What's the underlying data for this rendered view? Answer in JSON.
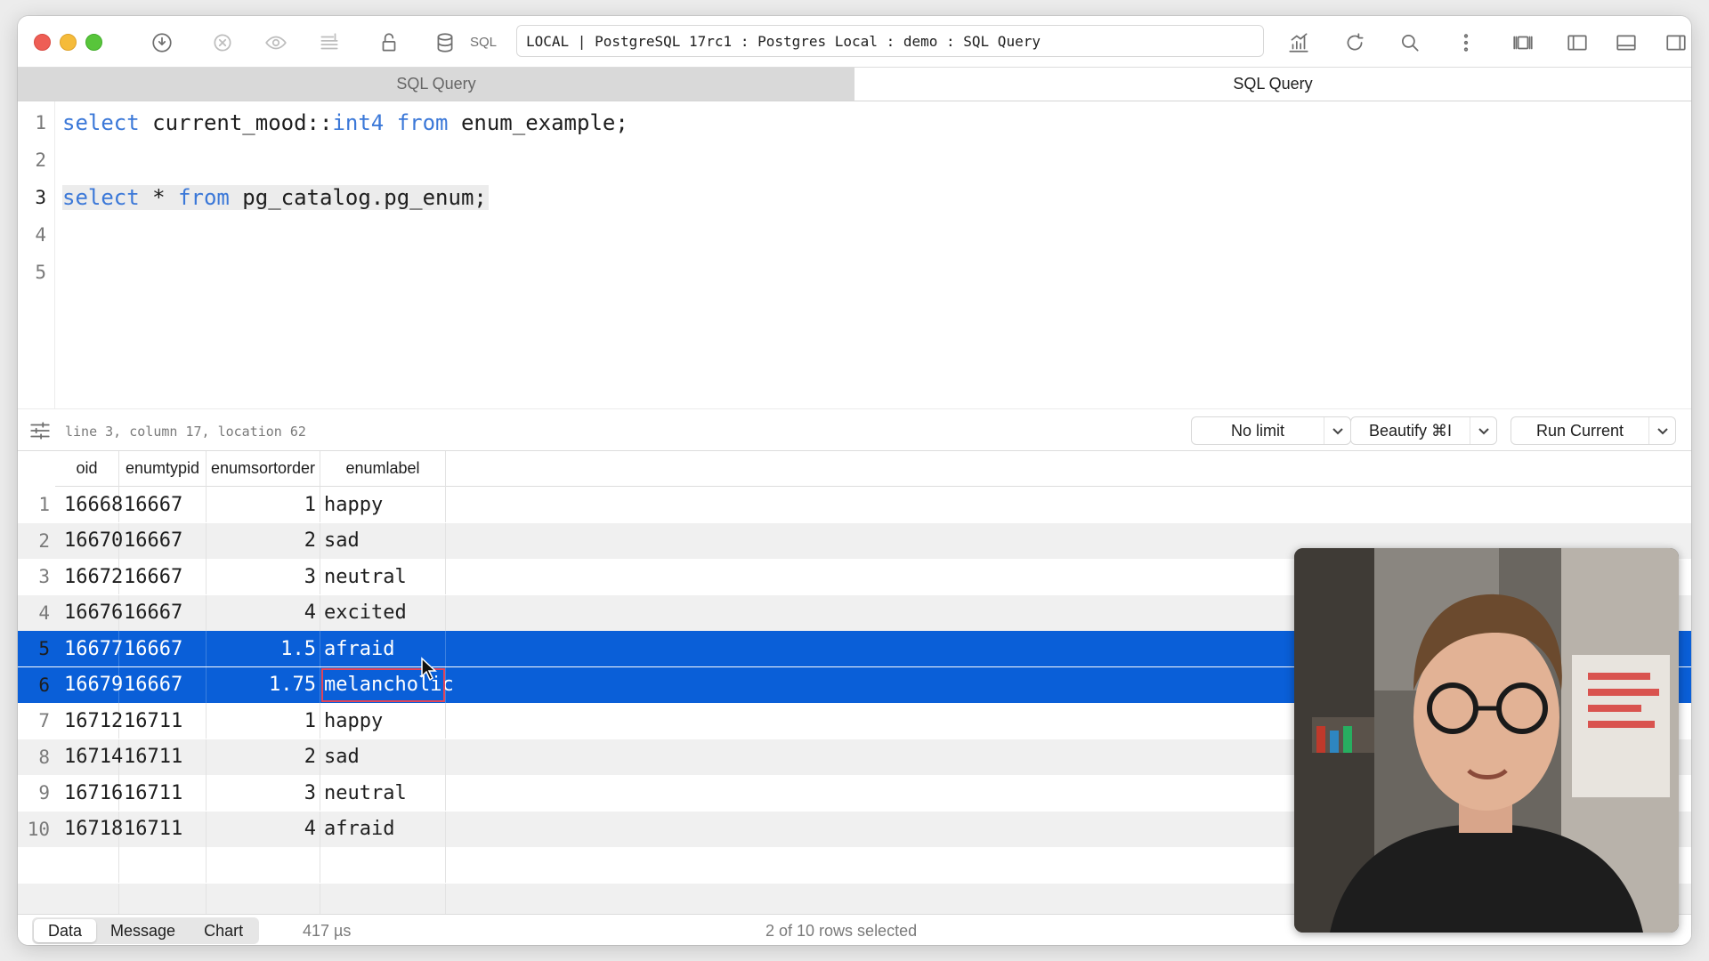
{
  "toolbar": {
    "sql_label": "SQL",
    "connection": "LOCAL | PostgreSQL 17rc1 : Postgres Local : demo : SQL Query"
  },
  "tabs": [
    {
      "label": "SQL Query",
      "active": false
    },
    {
      "label": "SQL Query",
      "active": true
    }
  ],
  "editor": {
    "line_numbers": [
      "1",
      "2",
      "3",
      "4",
      "5"
    ],
    "current_line": 3,
    "line1": {
      "kw1": "select",
      "t1": " current_mood::",
      "kw2": "int4",
      "t2": " ",
      "kw3": "from",
      "t3": " enum_example;"
    },
    "line3": {
      "kw1": "select",
      "t1": " * ",
      "kw2": "from",
      "t2": " pg_catalog.pg_enum;"
    }
  },
  "status": {
    "cursor_info": "line 3, column 17, location 62",
    "limit_label": "No limit",
    "beautify_label": "Beautify ⌘I",
    "run_label": "Run Current"
  },
  "results": {
    "columns": [
      "oid",
      "enumtypid",
      "enumsortorder",
      "enumlabel"
    ],
    "rows": [
      {
        "n": "1",
        "oid": "16668",
        "typid": "16667",
        "order": "1",
        "label": "happy"
      },
      {
        "n": "2",
        "oid": "16670",
        "typid": "16667",
        "order": "2",
        "label": "sad"
      },
      {
        "n": "3",
        "oid": "16672",
        "typid": "16667",
        "order": "3",
        "label": "neutral"
      },
      {
        "n": "4",
        "oid": "16676",
        "typid": "16667",
        "order": "4",
        "label": "excited"
      },
      {
        "n": "5",
        "oid": "16677",
        "typid": "16667",
        "order": "1.5",
        "label": "afraid"
      },
      {
        "n": "6",
        "oid": "16679",
        "typid": "16667",
        "order": "1.75",
        "label": "melancholic"
      },
      {
        "n": "7",
        "oid": "16712",
        "typid": "16711",
        "order": "1",
        "label": "happy"
      },
      {
        "n": "8",
        "oid": "16714",
        "typid": "16711",
        "order": "2",
        "label": "sad"
      },
      {
        "n": "9",
        "oid": "16716",
        "typid": "16711",
        "order": "3",
        "label": "neutral"
      },
      {
        "n": "10",
        "oid": "16718",
        "typid": "16711",
        "order": "4",
        "label": "afraid"
      }
    ],
    "selected_rows": [
      5,
      6
    ]
  },
  "bottom": {
    "tabs": [
      "Data",
      "Message",
      "Chart"
    ],
    "active_tab": "Data",
    "timing": "417 µs",
    "selection_status": "2 of 10 rows selected"
  },
  "colors": {
    "keyword": "#3b78d8",
    "selection": "#0a5fd8",
    "focus_outline": "#e0455a"
  }
}
